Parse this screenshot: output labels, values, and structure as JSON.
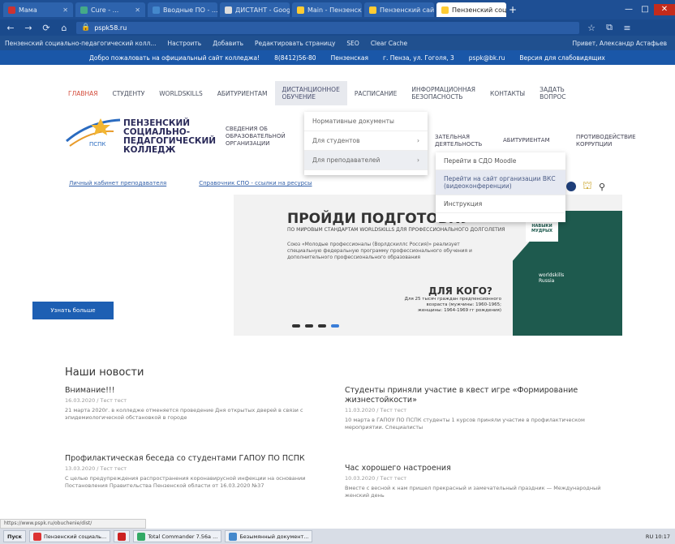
{
  "browser": {
    "tabs": [
      "Мама",
      "Cure - ...",
      "Вводные ПО - ...",
      "ДИСТАНТ - Google ...",
      "Main - Пензенский ...",
      "Пензенский сайт ...",
      "Пензенский социал...",
      "+"
    ],
    "url": "pspk58.ru",
    "bookmarks": [
      "Пензенский социально-педагогический колл...",
      "Настроить",
      "Добавить",
      "Редактировать страницу",
      "SEO",
      "Clear Cache",
      "Привет, Александр Астафьев"
    ],
    "controls": {
      "min": "—",
      "max": "□",
      "close": "✕"
    }
  },
  "infobar": {
    "left": "Добро пожаловать на официальный сайт колледжа!",
    "phone": "8(8412)56-80",
    "city": "Пензенская",
    "address": "г. Пенза, ул. Гоголя, 3",
    "email": "pspk@bk.ru",
    "version": "Версия для слабовидящих"
  },
  "nav": {
    "items": [
      "ГЛАВНАЯ",
      "СТУДЕНТУ",
      "WORLDSKILLS",
      "АБИТУРИЕНТАМ",
      "ДИСТАНЦИОННОЕ\nОБУЧЕНИЕ",
      "РАСПИСАНИЕ",
      "ИНФОРМАЦИОННАЯ\nБЕЗОПАСНОСТЬ",
      "КОНТАКТЫ",
      "ЗАДАТЬ\nВОПРОС"
    ]
  },
  "logo": {
    "text": "ПЕНЗЕНСКИЙ СОЦИАЛЬНО-ПЕДАГОГИЧЕСКИЙ КОЛЛЕДЖ",
    "abbr": "ПСПК"
  },
  "subnav": {
    "a": "СВЕДЕНИЯ ОБ\nОБРАЗОВАТЕЛЬНОЙ\nОРГАНИЗАЦИИ",
    "b": "ЗАТЕЛЬНАЯ\nДЕЯТЕЛЬНОСТЬ",
    "c": "АБИТУРИЕНТАМ",
    "d": "ПРОТИВОДЕЙСТВИЕ\nКОРРУПЦИИ"
  },
  "links": [
    "Личный кабинет преподавателя",
    "Справочник СПО - ссылки на ресурсы"
  ],
  "dropdown": {
    "items": [
      "Нормативные документы",
      "Для студентов",
      "Для преподавателей"
    ]
  },
  "submenu": {
    "items": [
      "Перейти в СДО Moodle",
      "Перейти на сайт организации ВКС (видеоконференции)",
      "Инструкция"
    ]
  },
  "banner": {
    "title": "ПРОЙДИ ПОДГОТОВКУ",
    "sub": "по мировым стандартам WorldSkills для профессионального долголетия",
    "text": "Союз «Молодые профессионалы (Ворлдскиллс Россия)» реализует специальную федеральную программу профессионального обучения и дополнительного профессионального образования",
    "q": "ДЛЯ КОГО?",
    "qs": "Для 25 тысяч граждан предпенсионного возраста (мужчины: 1960-1965; женщины: 1964-1969 гг рождения)",
    "badge": "worldskills Russia",
    "navi": "НАВЫКИ МУДРЫХ"
  },
  "more_button": "Узнать больше",
  "news": {
    "title": "Наши новости",
    "items": [
      {
        "t": "Внимание!!!",
        "m": "16.03.2020 / Тест тест",
        "d": "21 марта 2020г. в колледже отменяется проведение Дня открытых дверей в связи с эпидемиологической обстановкой в городе"
      },
      {
        "t": "Профилактическая беседа со студентами ГАПОУ ПО ПСПК",
        "m": "13.03.2020 / Тест тест",
        "d": "С целью предупреждения распространения коронавирусной инфекции на основании Постановления Правительства Пензенской области от 16.03.2020 №37"
      },
      {
        "t": "Студенты приняли участие в квест игре «Формирование жизнестойкости»",
        "m": "11.03.2020 / Тест тест",
        "d": "10 марта в ГАПОУ ПО ПСПК студенты 1 курсов приняли участие в профилактическом мероприятии. Специалисты"
      },
      {
        "t": "Час хорошего настроения",
        "m": "10.03.2020 / Тест тест",
        "d": "Вместе с весной к нам пришел прекрасный и замечательный праздник — Международный женский день"
      }
    ]
  },
  "status_url": "https://www.pspk.ru/obuchenie/dist/",
  "taskbar": {
    "start": "Пуск",
    "items": [
      "Пензенский социаль...",
      "Total Commander 7.56a ...",
      "Безымянный документ..."
    ],
    "clock": "RU 10:17"
  },
  "colors": {
    "tabstrip": "#1e4f94",
    "infobar": "#1a57a8",
    "accent": "#d34b3a",
    "button": "#1d5fb3"
  }
}
